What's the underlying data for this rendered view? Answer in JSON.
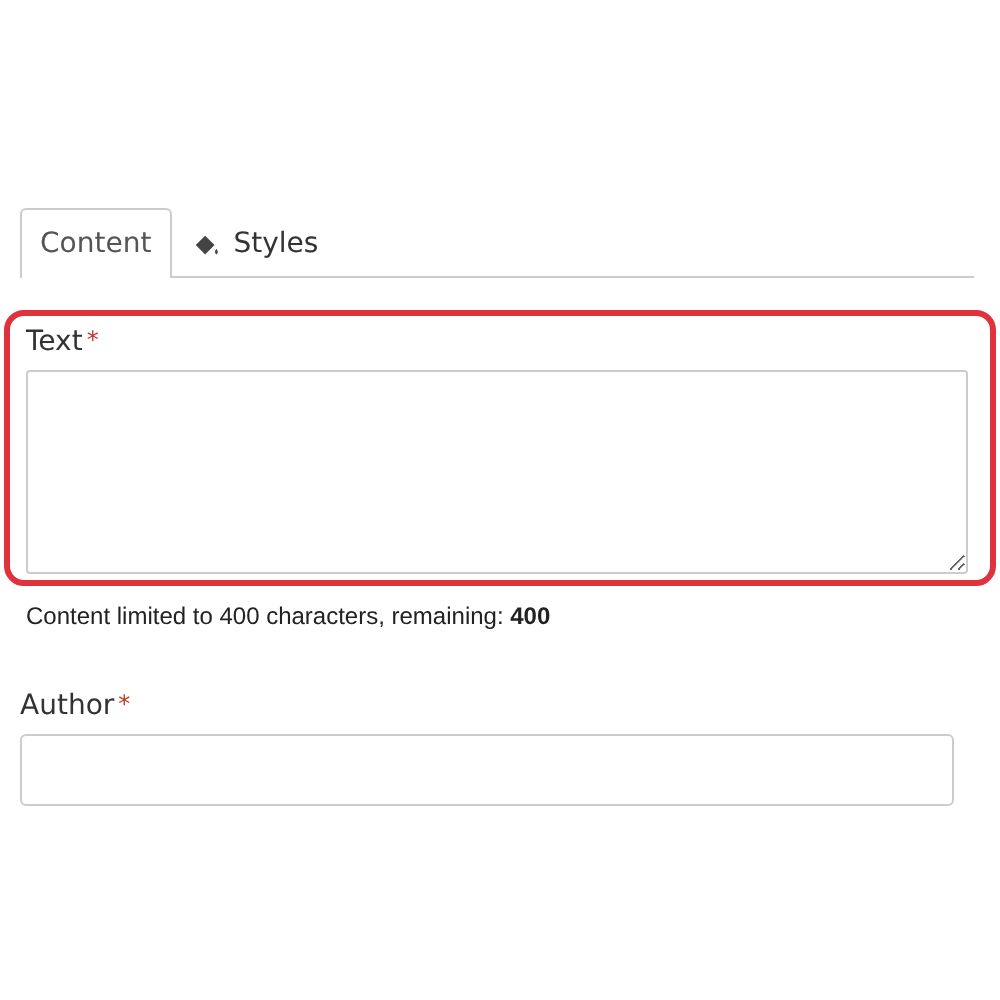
{
  "tabs": [
    {
      "label": "Content",
      "selected": true,
      "icon": false
    },
    {
      "label": "Styles",
      "selected": false,
      "icon": true
    }
  ],
  "fields": [
    {
      "kind": "textarea",
      "label": "Text",
      "required_mark": "*",
      "highlighted": true,
      "help": "Content limited to 400 characters, remaining: **400**"
    },
    {
      "kind": "input",
      "label": "Author",
      "required_mark": "*",
      "highlighted": false
    }
  ]
}
